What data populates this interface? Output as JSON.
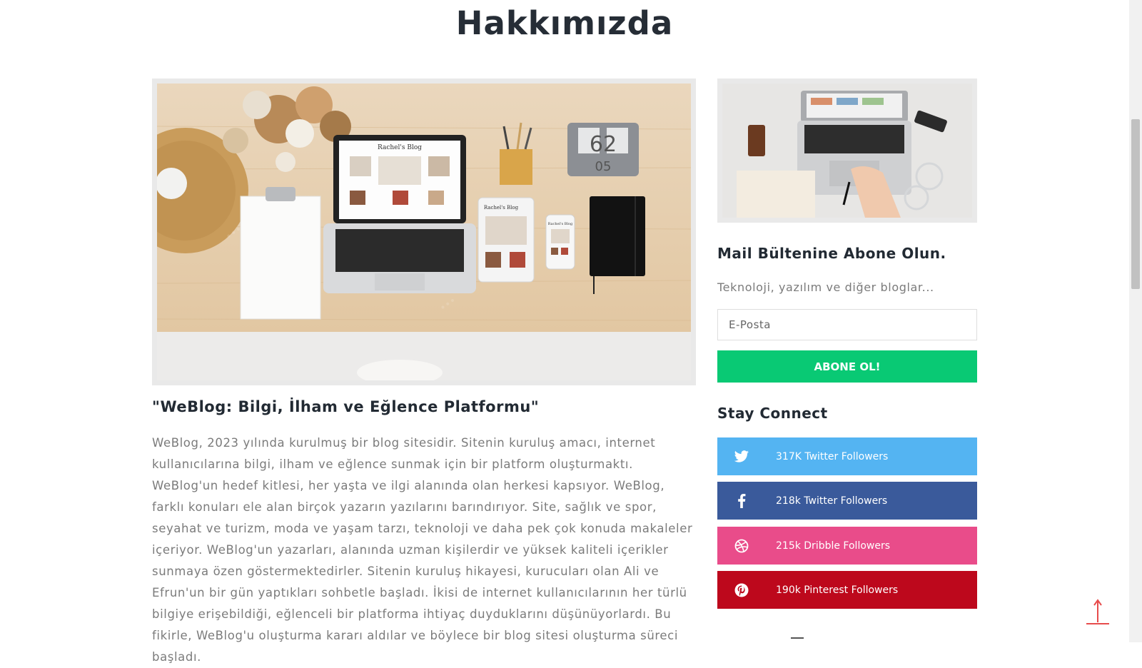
{
  "page": {
    "title": "Hakkımızda"
  },
  "article": {
    "title": "\"WeBlog: Bilgi, İlham ve Eğlence Platformu\"",
    "body": "WeBlog, 2023 yılında kurulmuş bir blog sitesidir. Sitenin kuruluş amacı, internet kullanıcılarına bilgi, ilham ve eğlence sunmak için bir platform oluşturmaktı. WeBlog'un hedef kitlesi, her yaşta ve ilgi alanında olan herkesi kapsıyor. WeBlog, farklı konuları ele alan birçok yazarın yazılarını barındırıyor. Site, sağlık ve spor, seyahat ve turizm, moda ve yaşam tarzı, teknoloji ve daha pek çok konuda makaleler içeriyor. WeBlog'un yazarları, alanında uzman kişilerdir ve yüksek kaliteli içerikler sunmaya özen göstermektedirler. Sitenin kuruluş hikayesi, kurucuları olan Ali ve Efrun'un bir gün yaptıkları sohbetle başladı. İkisi de internet kullanıcılarının her türlü bilgiye erişebildiği, eğlenceli bir platforma ihtiyaç duyduklarını düşünüyorlardı. Bu fikirle, WeBlog'u oluşturma kararı aldılar ve böylece bir blog sitesi oluşturma süreci başladı.",
    "photo_label_laptop": "Rachel's Blog",
    "photo_label_tablet": "Rachel's Blog",
    "photo_label_phone": "Rachel's Blog",
    "photo_calendar_top": "62",
    "photo_calendar_bottom": "05"
  },
  "newsletter": {
    "title": "Mail Bültenine Abone Olun.",
    "description": "Teknoloji, yazılım ve diğer bloglar...",
    "email_placeholder": "E-Posta",
    "button_label": "ABONE OL!"
  },
  "social": {
    "title": "Stay Connect",
    "items": [
      {
        "label": "317K Twitter Followers",
        "icon": "twitter-icon",
        "color": "#54b4f2"
      },
      {
        "label": "218k Twitter Followers",
        "icon": "facebook-icon",
        "color": "#3a5a9b"
      },
      {
        "label": "215k Dribble Followers",
        "icon": "dribbble-icon",
        "color": "#e94c8a"
      },
      {
        "label": "190k Pinterest Followers",
        "icon": "pinterest-icon",
        "color": "#bd081c"
      }
    ]
  },
  "colors": {
    "accent_green": "#09c974",
    "scroll_top_arrow": "#e74c4c",
    "heading": "#222a33",
    "body_text": "#7b7b7b"
  }
}
